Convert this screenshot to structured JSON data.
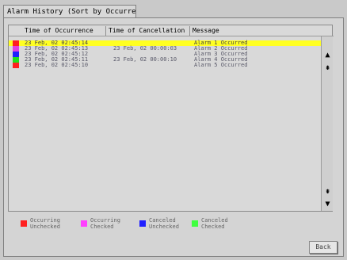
{
  "tab": {
    "label": "Alarm History (Sort by Occurrence)"
  },
  "header": {
    "occurrence": "Time of Occurrence",
    "cancellation": "Time of Cancellation",
    "message": "Message"
  },
  "rows": [
    {
      "color": "#ff2020",
      "occurrence": "23 Feb, 02 02:45:14",
      "cancellation": "",
      "message": "Alarm 1 Occurred",
      "selected": true
    },
    {
      "color": "#e040e0",
      "occurrence": "23 Feb, 02 02:45:13",
      "cancellation": "23 Feb, 02 00:00:03",
      "message": "Alarm 2 Occurred",
      "selected": false
    },
    {
      "color": "#2020ff",
      "occurrence": "23 Feb, 02 02:45:12",
      "cancellation": "",
      "message": "Alarm 3 Occurred",
      "selected": false
    },
    {
      "color": "#20e020",
      "occurrence": "23 Feb, 02 02:45:11",
      "cancellation": "23 Feb, 02 00:00:10",
      "message": "Alarm 4 Occurred",
      "selected": false
    },
    {
      "color": "#ff2020",
      "occurrence": "23 Feb, 02 02:45:10",
      "cancellation": "",
      "message": "Alarm 5 Occurred",
      "selected": false
    }
  ],
  "legend": [
    {
      "color": "#ff2020",
      "label": "Occurring\nUnchecked"
    },
    {
      "color": "#ff40ff",
      "label": "Occurring\nChecked"
    },
    {
      "color": "#2020ff",
      "label": "Canceled\nUnchecked"
    },
    {
      "color": "#40ff40",
      "label": "Canceled\nChecked"
    }
  ],
  "scroll": {
    "up_icon": "arrow-up-icon",
    "page_up_icon": "page-up-icon",
    "page_down_icon": "page-down-icon",
    "down_icon": "arrow-down-icon"
  },
  "back_button": {
    "label": "Back"
  }
}
